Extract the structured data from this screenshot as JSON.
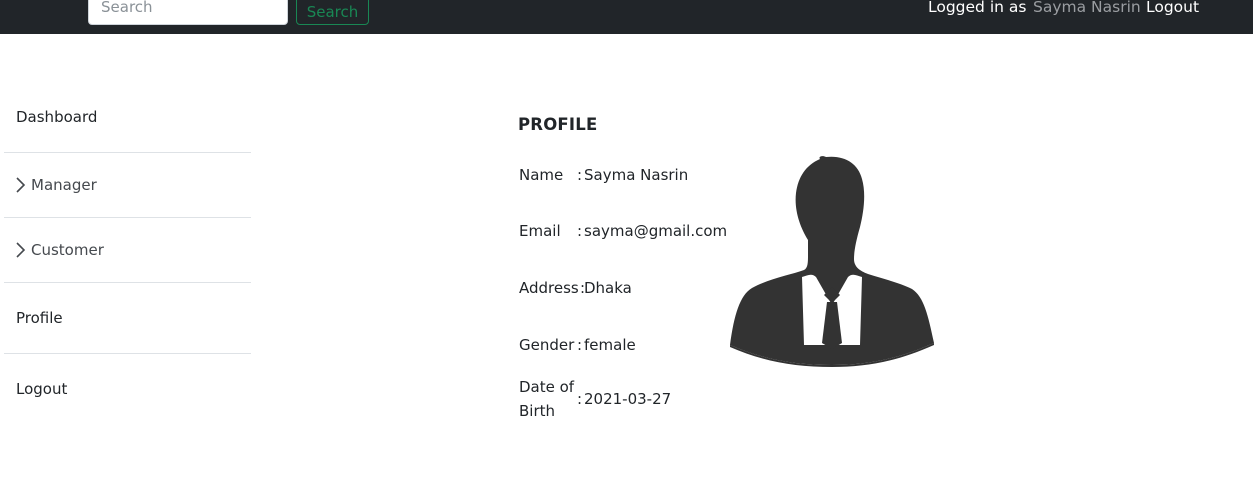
{
  "navbar": {
    "search_placeholder": "Search",
    "search_button": "Search",
    "logged_in_label": "Logged in as",
    "username": "Sayma Nasrin",
    "logout": "Logout"
  },
  "sidebar": {
    "items": [
      {
        "label": "Dashboard"
      },
      {
        "label": "Manager"
      },
      {
        "label": "Customer"
      },
      {
        "label": "Profile"
      },
      {
        "label": "Logout"
      }
    ]
  },
  "profile": {
    "title": "PROFILE",
    "colon": ":",
    "name_label": "Name",
    "name": "Sayma Nasrin",
    "email_label": "Email",
    "email": "sayma@gmail.com",
    "address_label": "Address",
    "address": "Dhaka",
    "gender_label": "Gender",
    "gender": "female",
    "dob_label_line1": "Date of",
    "dob_label_line2": "Birth",
    "dob": "2021-03-27"
  },
  "icons": {
    "chevron": "chevron-right-icon",
    "avatar": "user-silhouette-icon"
  },
  "colors": {
    "navbar_bg": "#212529",
    "search_button": "#198754",
    "username": "#9a9da1",
    "avatar": "#333333"
  }
}
